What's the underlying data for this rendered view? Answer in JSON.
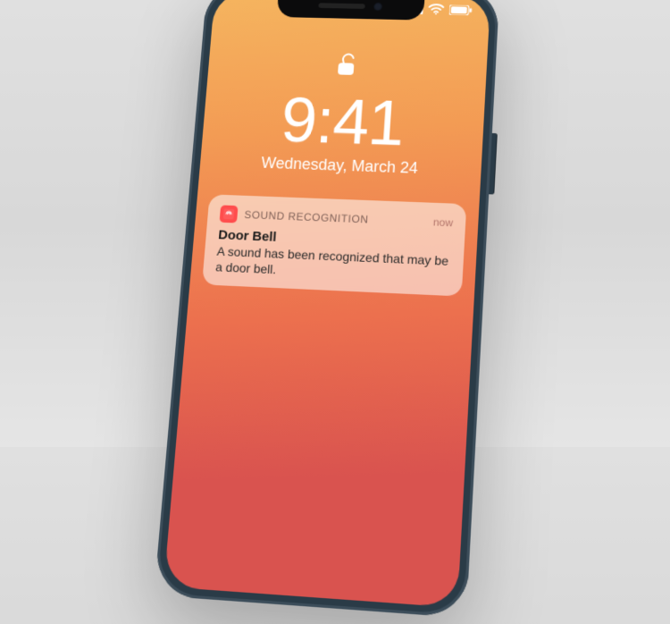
{
  "status_bar": {
    "signal_icon": "signal-icon",
    "wifi_icon": "wifi-icon",
    "battery_icon": "battery-icon"
  },
  "lock_screen": {
    "lock_icon": "unlock-icon",
    "time": "9:41",
    "date": "Wednesday, March 24"
  },
  "notification": {
    "app_icon": "sound-recognition-icon",
    "app_name": "SOUND RECOGNITION",
    "timestamp": "now",
    "title": "Door Bell",
    "body": "A sound has been recognized that may be a door bell."
  }
}
